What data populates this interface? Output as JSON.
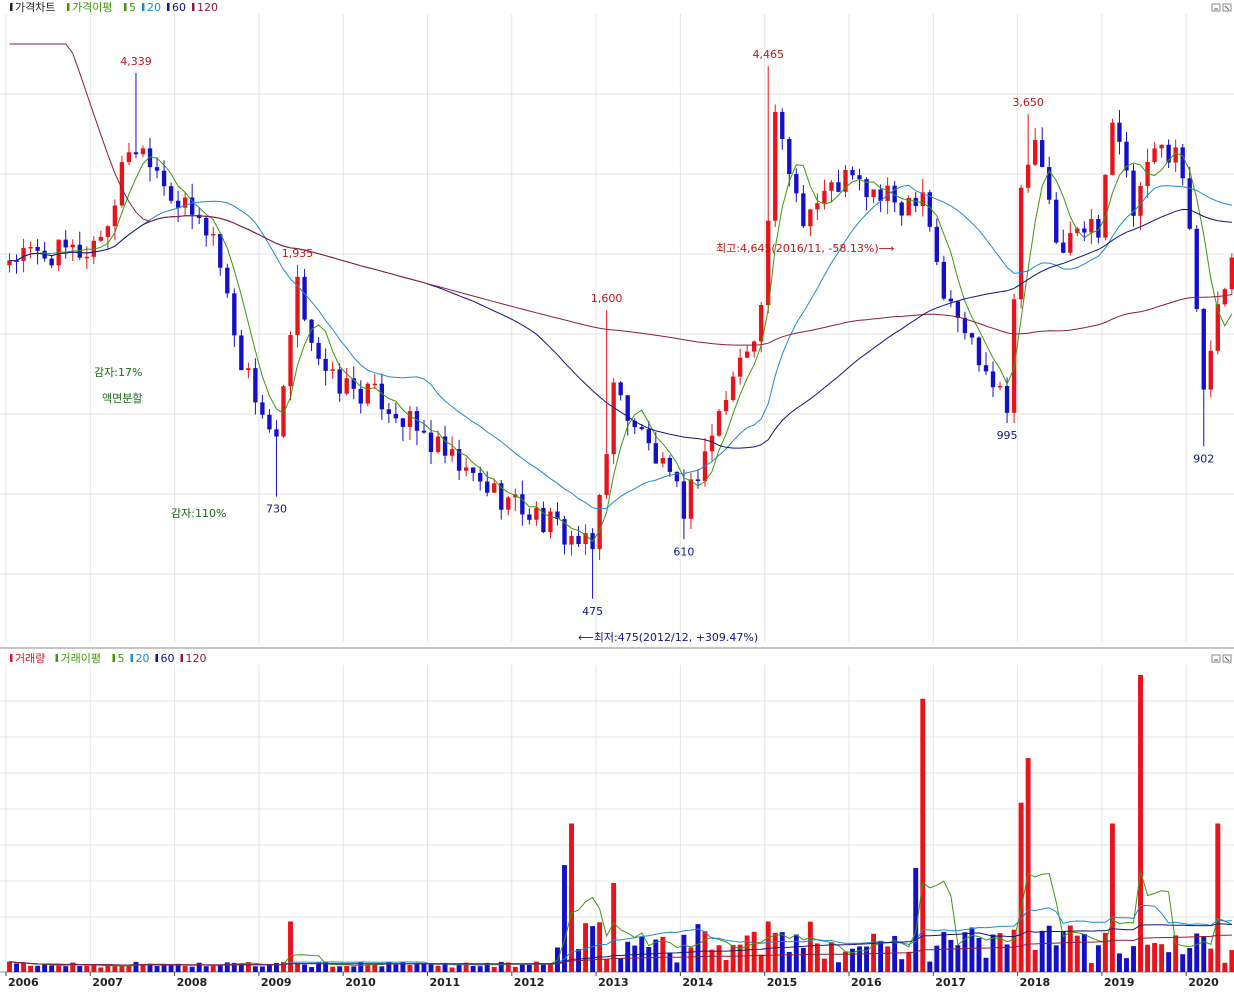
{
  "colors": {
    "up": "#e8141b",
    "down": "#1410c8",
    "ma5": "#3c9a0a",
    "ma20": "#1f8ad6",
    "ma60": "#141480",
    "ma120": "#8b1e3f",
    "grid": "#e4e4e4",
    "annot_green": "#1a6a1a"
  },
  "price_panel": {
    "legend": [
      {
        "label": "가격차트",
        "color": "#222222"
      },
      {
        "label": "가격이평",
        "color": "#3c9a0a"
      },
      {
        "label": "5",
        "color": "#3c9a0a"
      },
      {
        "label": "20",
        "color": "#1f8ad6"
      },
      {
        "label": "60",
        "color": "#141480"
      },
      {
        "label": "120",
        "color": "#8b1e3f"
      }
    ],
    "window_icons": [
      "minimize-icon",
      "close-icon"
    ]
  },
  "volume_panel": {
    "legend": [
      {
        "label": "거래량",
        "color": "#e8141b"
      },
      {
        "label": "거래이평",
        "color": "#3c9a0a"
      },
      {
        "label": "5",
        "color": "#3c9a0a"
      },
      {
        "label": "20",
        "color": "#1f8ad6"
      },
      {
        "label": "60",
        "color": "#141480"
      },
      {
        "label": "120",
        "color": "#8b1e3f"
      }
    ],
    "window_icons": [
      "minimize-icon",
      "close-icon"
    ]
  },
  "annotations": {
    "high": "최고:4,645(2016/11, -58.13%)⟶",
    "low": "⟵최저:475(2012/12, +309.47%)",
    "events": [
      "감자:17%",
      "액면분할",
      "감자:110%"
    ]
  },
  "chart_data": {
    "type": "candlestick",
    "title": "",
    "period": "monthly",
    "x_labels": [
      "2006",
      "2007",
      "2008",
      "2009",
      "2010",
      "2011",
      "2012",
      "2013",
      "2014",
      "2015",
      "2016",
      "2017",
      "2018",
      "2019",
      "2020"
    ],
    "peak_labels": [
      {
        "value": 4339,
        "label": "4,339",
        "date": "2007/07",
        "kind": "high"
      },
      {
        "value": 730,
        "label": "730",
        "date": "2009/03",
        "kind": "low"
      },
      {
        "value": 1935,
        "label": "1,935",
        "date": "2009/06",
        "kind": "high"
      },
      {
        "value": 475,
        "label": "475",
        "date": "2012/12",
        "kind": "low"
      },
      {
        "value": 1600,
        "label": "1,600",
        "date": "2013/02",
        "kind": "high"
      },
      {
        "value": 610,
        "label": "610",
        "date": "2014/01",
        "kind": "low"
      },
      {
        "value": 4465,
        "label": "4,465",
        "date": "2015/01",
        "kind": "high"
      },
      {
        "value": 995,
        "label": "995",
        "date": "2017/11",
        "kind": "low"
      },
      {
        "value": 3650,
        "label": "3,650",
        "date": "2018/02",
        "kind": "high"
      },
      {
        "value": 902,
        "label": "902",
        "date": "2020/03",
        "kind": "low"
      }
    ],
    "price_anchors": [
      {
        "date": "2006/01",
        "close": 2000
      },
      {
        "date": "2006/12",
        "close": 2050
      },
      {
        "date": "2007/03",
        "close": 2300
      },
      {
        "date": "2007/06",
        "close": 3200
      },
      {
        "date": "2007/09",
        "close": 3100
      },
      {
        "date": "2008/01",
        "close": 2500
      },
      {
        "date": "2008/06",
        "close": 2200
      },
      {
        "date": "2008/10",
        "close": 1300
      },
      {
        "date": "2009/03",
        "close": 900
      },
      {
        "date": "2009/06",
        "close": 1750
      },
      {
        "date": "2009/10",
        "close": 1200
      },
      {
        "date": "2010/06",
        "close": 1100
      },
      {
        "date": "2011/06",
        "close": 800
      },
      {
        "date": "2012/06",
        "close": 650
      },
      {
        "date": "2012/12",
        "close": 580
      },
      {
        "date": "2013/03",
        "close": 1150
      },
      {
        "date": "2013/08",
        "close": 900
      },
      {
        "date": "2014/01",
        "close": 700
      },
      {
        "date": "2014/08",
        "close": 1200
      },
      {
        "date": "2014/12",
        "close": 1600
      },
      {
        "date": "2015/02",
        "close": 3500
      },
      {
        "date": "2015/06",
        "close": 2400
      },
      {
        "date": "2015/12",
        "close": 2800
      },
      {
        "date": "2016/04",
        "close": 2600
      },
      {
        "date": "2016/08",
        "close": 2500
      },
      {
        "date": "2016/11",
        "close": 2700
      },
      {
        "date": "2017/02",
        "close": 1700
      },
      {
        "date": "2017/06",
        "close": 1400
      },
      {
        "date": "2017/11",
        "close": 1100
      },
      {
        "date": "2018/01",
        "close": 2600
      },
      {
        "date": "2018/03",
        "close": 3300
      },
      {
        "date": "2018/06",
        "close": 2100
      },
      {
        "date": "2018/12",
        "close": 2300
      },
      {
        "date": "2019/02",
        "close": 3600
      },
      {
        "date": "2019/05",
        "close": 2400
      },
      {
        "date": "2019/08",
        "close": 3100
      },
      {
        "date": "2019/11",
        "close": 3200
      },
      {
        "date": "2020/01",
        "close": 2300
      },
      {
        "date": "2020/03",
        "close": 1200
      },
      {
        "date": "2020/07",
        "close": 2000
      }
    ],
    "volume_relative": [
      {
        "date": "2009/05",
        "rel": 0.17
      },
      {
        "date": "2012/08",
        "rel": 0.36
      },
      {
        "date": "2012/09",
        "rel": 0.5
      },
      {
        "date": "2013/03",
        "rel": 0.3
      },
      {
        "date": "2015/01",
        "rel": 0.17
      },
      {
        "date": "2016/10",
        "rel": 0.35
      },
      {
        "date": "2016/11",
        "rel": 0.92
      },
      {
        "date": "2018/01",
        "rel": 0.57
      },
      {
        "date": "2018/02",
        "rel": 0.72
      },
      {
        "date": "2019/02",
        "rel": 0.5
      },
      {
        "date": "2019/06",
        "rel": 1.0
      },
      {
        "date": "2020/05",
        "rel": 0.5
      }
    ],
    "grid": true
  }
}
